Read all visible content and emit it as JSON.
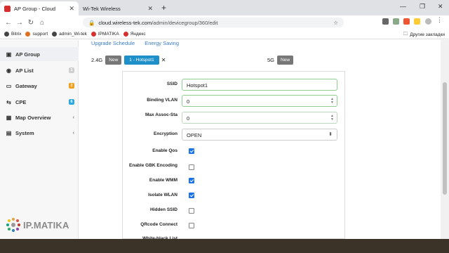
{
  "browser": {
    "tabs": [
      {
        "title": "AP Group - Cloud",
        "active": true
      },
      {
        "title": "Wi-Tek Wireless",
        "active": false
      }
    ],
    "new_tab": "+",
    "url_host": "cloud.wireless-tek.com",
    "url_path": "/admin/devicegroup/360/edit",
    "bookmarks": [
      {
        "label": "Bitrix",
        "color": "#444444"
      },
      {
        "label": "support",
        "color": "#e07020"
      },
      {
        "label": "admin_Wi-tek",
        "color": "#444444"
      },
      {
        "label": "IPMATIKA",
        "color": "#d62f2f"
      },
      {
        "label": "Яндекс",
        "color": "#d62f2f"
      }
    ],
    "other_bookmarks": "Другие закладки"
  },
  "sidebar": {
    "items": [
      {
        "label": "AP Group",
        "icon": "briefcase-icon",
        "active": true
      },
      {
        "label": "AP List",
        "icon": "broadcast-icon",
        "badge": "1",
        "badge_color": "#cfcfcf"
      },
      {
        "label": "Gateway",
        "icon": "gateway-icon",
        "badge": "2",
        "badge_color": "#f0a020"
      },
      {
        "label": "CPE",
        "icon": "cpe-icon",
        "badge": "6",
        "badge_color": "#2fa8e0"
      },
      {
        "label": "Map Overview",
        "icon": "map-icon",
        "chevron": "‹"
      },
      {
        "label": "System",
        "icon": "gear-icon",
        "chevron": "‹"
      }
    ],
    "logo_text": "IP.MATIKA"
  },
  "main": {
    "subtabs": [
      "Upgrade Schedule",
      "Energy Saving"
    ],
    "band24": {
      "label": "2.4G",
      "new_label": "New",
      "ssid_tab": "1 - Hotspot1"
    },
    "band5": {
      "label": "5G",
      "new_label": "New"
    },
    "form": {
      "ssid_label": "SSID",
      "ssid_value": "Hotspot1",
      "vlan_label": "Binding VLAN",
      "vlan_value": "0",
      "assoc_label": "Max Assoc-Sta",
      "assoc_value": "0",
      "encryption_label": "Encryption",
      "encryption_value": "OPEN",
      "checkboxes": [
        {
          "label": "Enable Qos",
          "checked": true
        },
        {
          "label": "Enable GBK Encoding",
          "checked": false
        },
        {
          "label": "Enable WMM",
          "checked": true
        },
        {
          "label": "Isolate WLAN",
          "checked": true
        },
        {
          "label": "Hidden SSID",
          "checked": false
        },
        {
          "label": "QRcode Connect",
          "checked": false
        }
      ],
      "whitelist_label": "White-black List"
    }
  }
}
